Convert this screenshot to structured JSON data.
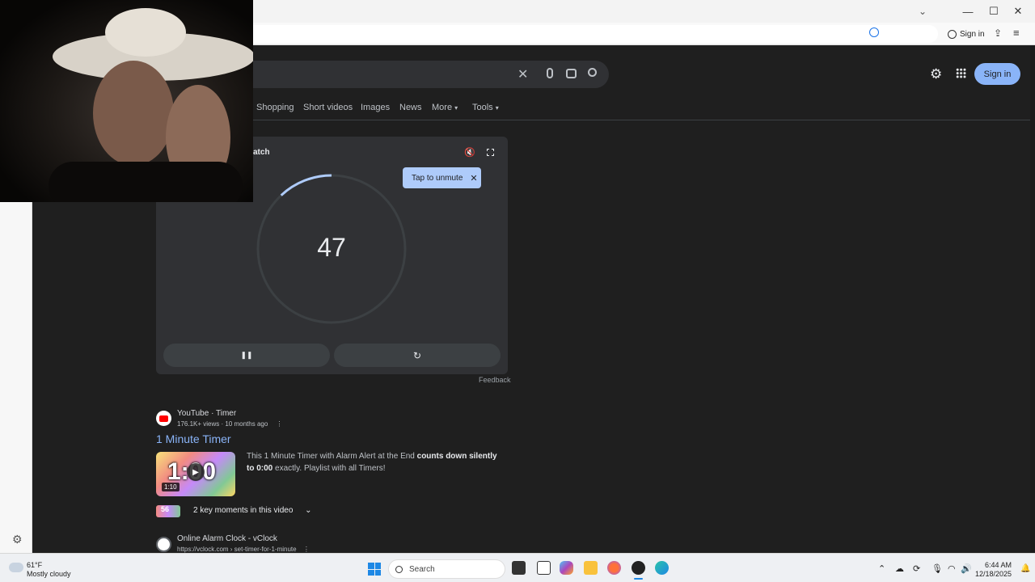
{
  "browser": {
    "signin_label": "Sign in"
  },
  "search": {
    "query": "",
    "tabs": [
      "Shopping",
      "Short videos",
      "Images",
      "News",
      "More",
      "Tools"
    ],
    "signin_label": "Sign in"
  },
  "timer_card": {
    "title_fragment": "atch",
    "value": "47",
    "progress_fraction": 0.12,
    "tooltip": "Tap to unmute",
    "pause_label": "❚❚",
    "reset_label": "↻",
    "feedback": "Feedback"
  },
  "results": [
    {
      "source": "YouTube · Timer",
      "meta": "176.1K+ views · 10 months ago",
      "title": "1 Minute Timer",
      "snippet_plain": "This 1 Minute Timer with Alarm Alert at the End ",
      "snippet_bold": "counts down silently to 0:00",
      "snippet_tail": " exactly. Playlist with all Timers!",
      "thumb_text": "1:00",
      "duration": "1:10",
      "key_moments": "2 key moments in this video",
      "key_thumb": "56"
    },
    {
      "source": "Online Alarm Clock - vClock",
      "url": "https://vclock.com › set-timer-for-1-minute"
    }
  ],
  "taskbar": {
    "weather_temp": "61°F",
    "weather_desc": "Mostly cloudy",
    "search_label": "Search",
    "time": "6:44 AM",
    "date": "12/18/2025"
  },
  "colors": {
    "accent_blue": "#8ab4f8",
    "page_bg": "#1f1f1f",
    "card_bg": "#303134"
  }
}
